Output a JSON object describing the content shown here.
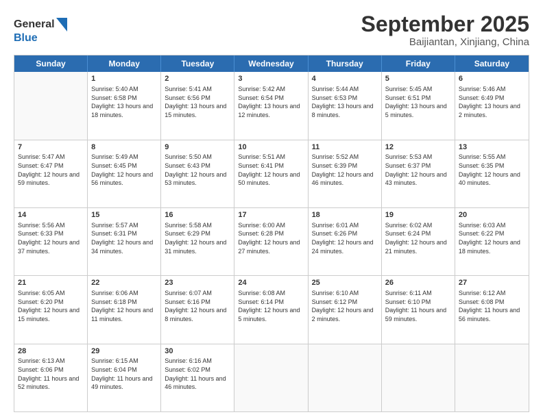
{
  "header": {
    "logo_line1": "General",
    "logo_line2": "Blue",
    "title": "September 2025",
    "subtitle": "Baijiantan, Xinjiang, China"
  },
  "weekdays": [
    "Sunday",
    "Monday",
    "Tuesday",
    "Wednesday",
    "Thursday",
    "Friday",
    "Saturday"
  ],
  "weeks": [
    [
      {
        "day": "",
        "sunrise": "",
        "sunset": "",
        "daylight": ""
      },
      {
        "day": "1",
        "sunrise": "Sunrise: 5:40 AM",
        "sunset": "Sunset: 6:58 PM",
        "daylight": "Daylight: 13 hours and 18 minutes."
      },
      {
        "day": "2",
        "sunrise": "Sunrise: 5:41 AM",
        "sunset": "Sunset: 6:56 PM",
        "daylight": "Daylight: 13 hours and 15 minutes."
      },
      {
        "day": "3",
        "sunrise": "Sunrise: 5:42 AM",
        "sunset": "Sunset: 6:54 PM",
        "daylight": "Daylight: 13 hours and 12 minutes."
      },
      {
        "day": "4",
        "sunrise": "Sunrise: 5:44 AM",
        "sunset": "Sunset: 6:53 PM",
        "daylight": "Daylight: 13 hours and 8 minutes."
      },
      {
        "day": "5",
        "sunrise": "Sunrise: 5:45 AM",
        "sunset": "Sunset: 6:51 PM",
        "daylight": "Daylight: 13 hours and 5 minutes."
      },
      {
        "day": "6",
        "sunrise": "Sunrise: 5:46 AM",
        "sunset": "Sunset: 6:49 PM",
        "daylight": "Daylight: 13 hours and 2 minutes."
      }
    ],
    [
      {
        "day": "7",
        "sunrise": "Sunrise: 5:47 AM",
        "sunset": "Sunset: 6:47 PM",
        "daylight": "Daylight: 12 hours and 59 minutes."
      },
      {
        "day": "8",
        "sunrise": "Sunrise: 5:49 AM",
        "sunset": "Sunset: 6:45 PM",
        "daylight": "Daylight: 12 hours and 56 minutes."
      },
      {
        "day": "9",
        "sunrise": "Sunrise: 5:50 AM",
        "sunset": "Sunset: 6:43 PM",
        "daylight": "Daylight: 12 hours and 53 minutes."
      },
      {
        "day": "10",
        "sunrise": "Sunrise: 5:51 AM",
        "sunset": "Sunset: 6:41 PM",
        "daylight": "Daylight: 12 hours and 50 minutes."
      },
      {
        "day": "11",
        "sunrise": "Sunrise: 5:52 AM",
        "sunset": "Sunset: 6:39 PM",
        "daylight": "Daylight: 12 hours and 46 minutes."
      },
      {
        "day": "12",
        "sunrise": "Sunrise: 5:53 AM",
        "sunset": "Sunset: 6:37 PM",
        "daylight": "Daylight: 12 hours and 43 minutes."
      },
      {
        "day": "13",
        "sunrise": "Sunrise: 5:55 AM",
        "sunset": "Sunset: 6:35 PM",
        "daylight": "Daylight: 12 hours and 40 minutes."
      }
    ],
    [
      {
        "day": "14",
        "sunrise": "Sunrise: 5:56 AM",
        "sunset": "Sunset: 6:33 PM",
        "daylight": "Daylight: 12 hours and 37 minutes."
      },
      {
        "day": "15",
        "sunrise": "Sunrise: 5:57 AM",
        "sunset": "Sunset: 6:31 PM",
        "daylight": "Daylight: 12 hours and 34 minutes."
      },
      {
        "day": "16",
        "sunrise": "Sunrise: 5:58 AM",
        "sunset": "Sunset: 6:29 PM",
        "daylight": "Daylight: 12 hours and 31 minutes."
      },
      {
        "day": "17",
        "sunrise": "Sunrise: 6:00 AM",
        "sunset": "Sunset: 6:28 PM",
        "daylight": "Daylight: 12 hours and 27 minutes."
      },
      {
        "day": "18",
        "sunrise": "Sunrise: 6:01 AM",
        "sunset": "Sunset: 6:26 PM",
        "daylight": "Daylight: 12 hours and 24 minutes."
      },
      {
        "day": "19",
        "sunrise": "Sunrise: 6:02 AM",
        "sunset": "Sunset: 6:24 PM",
        "daylight": "Daylight: 12 hours and 21 minutes."
      },
      {
        "day": "20",
        "sunrise": "Sunrise: 6:03 AM",
        "sunset": "Sunset: 6:22 PM",
        "daylight": "Daylight: 12 hours and 18 minutes."
      }
    ],
    [
      {
        "day": "21",
        "sunrise": "Sunrise: 6:05 AM",
        "sunset": "Sunset: 6:20 PM",
        "daylight": "Daylight: 12 hours and 15 minutes."
      },
      {
        "day": "22",
        "sunrise": "Sunrise: 6:06 AM",
        "sunset": "Sunset: 6:18 PM",
        "daylight": "Daylight: 12 hours and 11 minutes."
      },
      {
        "day": "23",
        "sunrise": "Sunrise: 6:07 AM",
        "sunset": "Sunset: 6:16 PM",
        "daylight": "Daylight: 12 hours and 8 minutes."
      },
      {
        "day": "24",
        "sunrise": "Sunrise: 6:08 AM",
        "sunset": "Sunset: 6:14 PM",
        "daylight": "Daylight: 12 hours and 5 minutes."
      },
      {
        "day": "25",
        "sunrise": "Sunrise: 6:10 AM",
        "sunset": "Sunset: 6:12 PM",
        "daylight": "Daylight: 12 hours and 2 minutes."
      },
      {
        "day": "26",
        "sunrise": "Sunrise: 6:11 AM",
        "sunset": "Sunset: 6:10 PM",
        "daylight": "Daylight: 11 hours and 59 minutes."
      },
      {
        "day": "27",
        "sunrise": "Sunrise: 6:12 AM",
        "sunset": "Sunset: 6:08 PM",
        "daylight": "Daylight: 11 hours and 56 minutes."
      }
    ],
    [
      {
        "day": "28",
        "sunrise": "Sunrise: 6:13 AM",
        "sunset": "Sunset: 6:06 PM",
        "daylight": "Daylight: 11 hours and 52 minutes."
      },
      {
        "day": "29",
        "sunrise": "Sunrise: 6:15 AM",
        "sunset": "Sunset: 6:04 PM",
        "daylight": "Daylight: 11 hours and 49 minutes."
      },
      {
        "day": "30",
        "sunrise": "Sunrise: 6:16 AM",
        "sunset": "Sunset: 6:02 PM",
        "daylight": "Daylight: 11 hours and 46 minutes."
      },
      {
        "day": "",
        "sunrise": "",
        "sunset": "",
        "daylight": ""
      },
      {
        "day": "",
        "sunrise": "",
        "sunset": "",
        "daylight": ""
      },
      {
        "day": "",
        "sunrise": "",
        "sunset": "",
        "daylight": ""
      },
      {
        "day": "",
        "sunrise": "",
        "sunset": "",
        "daylight": ""
      }
    ]
  ]
}
